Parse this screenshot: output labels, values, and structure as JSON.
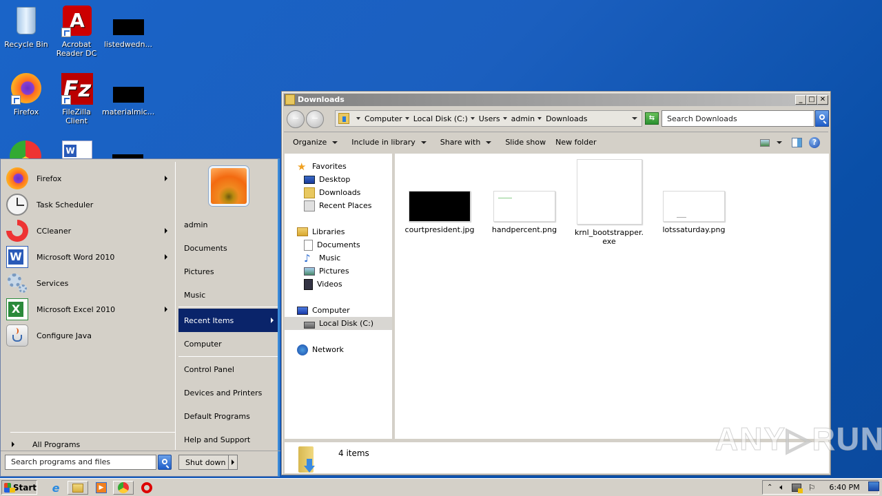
{
  "desktop": {
    "icons": [
      {
        "label": "Recycle Bin",
        "icon": "recycle-bin-icon"
      },
      {
        "label": "Acrobat Reader DC",
        "icon": "acrobat-icon"
      },
      {
        "label": "listedwedn...",
        "icon": "file-thumbnail-icon"
      },
      {
        "label": "Firefox",
        "icon": "firefox-icon"
      },
      {
        "label": "FileZilla Client",
        "icon": "filezilla-icon"
      },
      {
        "label": "materialmic...",
        "icon": "file-thumbnail-icon"
      }
    ]
  },
  "start_menu": {
    "programs": [
      {
        "label": "Firefox",
        "icon": "firefox-icon",
        "submenu": true
      },
      {
        "label": "Task Scheduler",
        "icon": "clock-icon",
        "submenu": false
      },
      {
        "label": "CCleaner",
        "icon": "ccleaner-icon",
        "submenu": true
      },
      {
        "label": "Microsoft Word 2010",
        "icon": "word-icon",
        "submenu": true
      },
      {
        "label": "Services",
        "icon": "gears-icon",
        "submenu": false
      },
      {
        "label": "Microsoft Excel 2010",
        "icon": "excel-icon",
        "submenu": true
      },
      {
        "label": "Configure Java",
        "icon": "java-icon",
        "submenu": false
      }
    ],
    "all_programs": "All Programs",
    "search_placeholder": "Search programs and files",
    "places": [
      {
        "label": "admin"
      },
      {
        "label": "Documents"
      },
      {
        "label": "Pictures"
      },
      {
        "label": "Music"
      },
      {
        "label": "Recent Items",
        "active": true
      },
      {
        "label": "Computer"
      },
      {
        "label": "Control Panel"
      },
      {
        "label": "Devices and Printers"
      },
      {
        "label": "Default Programs"
      },
      {
        "label": "Help and Support"
      }
    ],
    "shutdown": "Shut down"
  },
  "explorer": {
    "title": "Downloads",
    "breadcrumb": [
      "Computer",
      "Local Disk (C:)",
      "Users",
      "admin",
      "Downloads"
    ],
    "search_placeholder": "Search Downloads",
    "toolbar": {
      "organize": "Organize",
      "include": "Include in library",
      "share": "Share with",
      "slideshow": "Slide show",
      "newfolder": "New folder"
    },
    "nav": {
      "favorites": "Favorites",
      "desktop": "Desktop",
      "downloads": "Downloads",
      "recent": "Recent Places",
      "libraries": "Libraries",
      "documents": "Documents",
      "music": "Music",
      "pictures": "Pictures",
      "videos": "Videos",
      "computer": "Computer",
      "localdisk": "Local Disk (C:)",
      "network": "Network"
    },
    "files": [
      {
        "name": "courtpresident.jpg",
        "thumb": "dark-image"
      },
      {
        "name": "handpercent.png",
        "thumb": "light-image"
      },
      {
        "name": "krnl_bootstrapper.exe",
        "name_line1": "krnl_bootstrapper.",
        "name_line2": "exe",
        "thumb": "blank-exe"
      },
      {
        "name": "lotssaturday.png",
        "thumb": "light-image"
      }
    ],
    "status": "4 items"
  },
  "taskbar": {
    "start": "Start",
    "clock": "6:40 PM"
  },
  "watermark": "ANY▷RUN"
}
